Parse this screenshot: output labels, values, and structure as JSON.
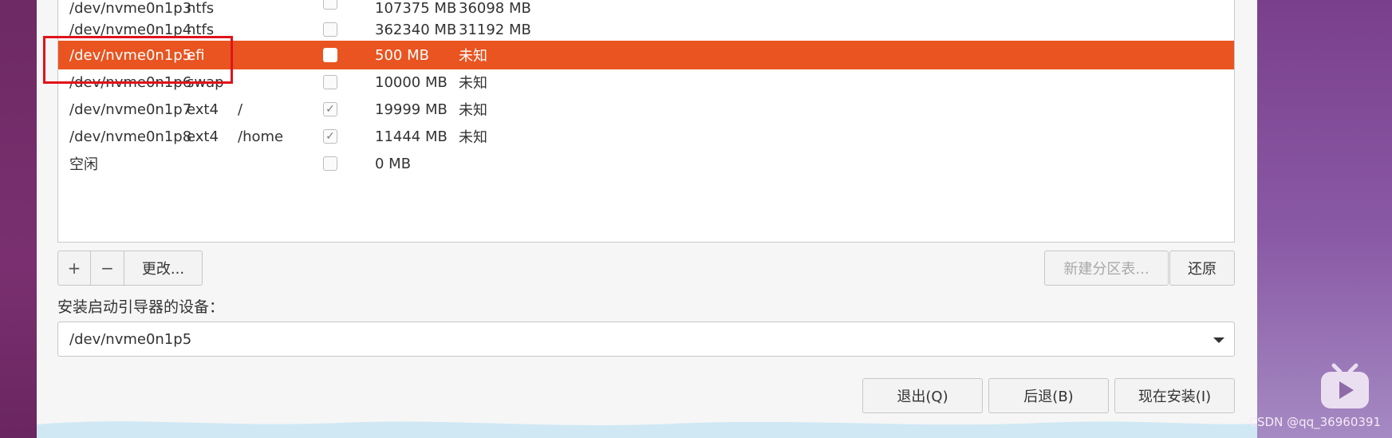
{
  "partitions": [
    {
      "device": "/dev/nvme0n1p3",
      "type": "ntfs",
      "mount": "",
      "format": false,
      "size": "107375 MB",
      "used": "36098 MB",
      "selected": false
    },
    {
      "device": "/dev/nvme0n1p4",
      "type": "ntfs",
      "mount": "",
      "format": false,
      "size": "362340 MB",
      "used": "31192 MB",
      "selected": false
    },
    {
      "device": "/dev/nvme0n1p5",
      "type": "efi",
      "mount": "",
      "format": false,
      "size": "500 MB",
      "used": "未知",
      "selected": true
    },
    {
      "device": "/dev/nvme0n1p6",
      "type": "swap",
      "mount": "",
      "format": false,
      "size": "10000 MB",
      "used": "未知",
      "selected": false
    },
    {
      "device": "/dev/nvme0n1p7",
      "type": "ext4",
      "mount": "/",
      "format": true,
      "size": "19999 MB",
      "used": "未知",
      "selected": false
    },
    {
      "device": "/dev/nvme0n1p8",
      "type": "ext4",
      "mount": "/home",
      "format": true,
      "size": "11444 MB",
      "used": "未知",
      "selected": false
    },
    {
      "device": "空闲",
      "type": "",
      "mount": "",
      "format": false,
      "size": "0 MB",
      "used": "",
      "selected": false
    }
  ],
  "toolbar": {
    "add": "+",
    "remove": "−",
    "change": "更改..."
  },
  "buttons": {
    "new_table": "新建分区表...",
    "revert": "还原",
    "quit": "退出(Q)",
    "back": "后退(B)",
    "install_now": "现在安装(I)"
  },
  "boot_loader": {
    "label": "安装启动引导器的设备：",
    "value": "/dev/nvme0n1p5"
  },
  "watermark": "CSDN @qq_36960391",
  "colors": {
    "selection": "#e95420",
    "highlight_box": "#e0131b"
  }
}
